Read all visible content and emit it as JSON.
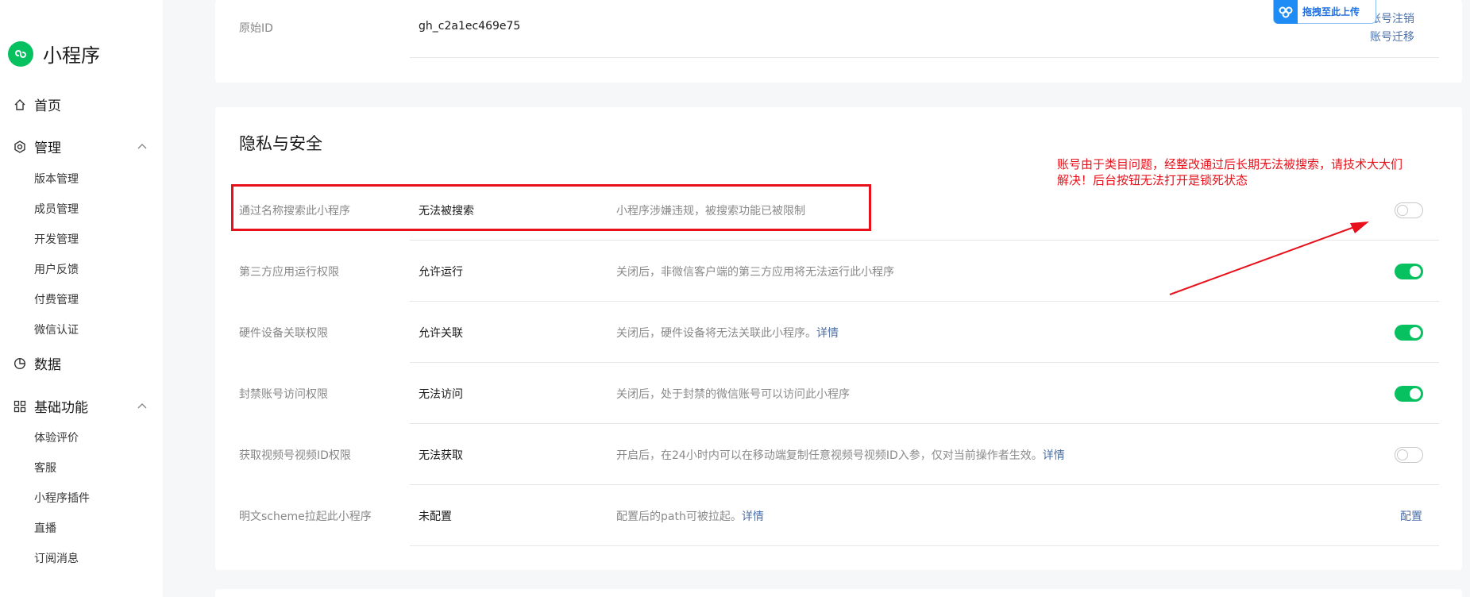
{
  "sidebar": {
    "title": "小程序",
    "items": [
      {
        "label": "首页"
      },
      {
        "label": "管理"
      },
      {
        "label": "数据"
      },
      {
        "label": "基础功能"
      }
    ],
    "manage_sub": [
      "版本管理",
      "成员管理",
      "开发管理",
      "用户反馈",
      "付费管理",
      "微信认证"
    ],
    "basic_sub": [
      "体验评价",
      "客服",
      "小程序插件",
      "直播",
      "订阅消息"
    ]
  },
  "top_card": {
    "label": "原始ID",
    "value": "gh_c2a1ec469e75",
    "link_cancel": "账号注销",
    "link_migrate": "账号迁移"
  },
  "upload_button": {
    "label": "拖拽至此上传"
  },
  "privacy": {
    "title": "隐私与安全",
    "rows": [
      {
        "label": "通过名称搜索此小程序",
        "value": "无法被搜索",
        "desc": "小程序涉嫌违规，被搜索功能已被限制",
        "link": "",
        "toggle": "off"
      },
      {
        "label": "第三方应用运行权限",
        "value": "允许运行",
        "desc": "关闭后，非微信客户端的第三方应用将无法运行此小程序",
        "link": "",
        "toggle": "on"
      },
      {
        "label": "硬件设备关联权限",
        "value": "允许关联",
        "desc": "关闭后，硬件设备将无法关联此小程序。",
        "link": "详情",
        "toggle": "on"
      },
      {
        "label": "封禁账号访问权限",
        "value": "无法访问",
        "desc": "关闭后，处于封禁的微信账号可以访问此小程序",
        "link": "",
        "toggle": "on"
      },
      {
        "label": "获取视频号视频ID权限",
        "value": "无法获取",
        "desc": "开启后，在24小时内可以在移动端复制任意视频号视频ID入参，仅对当前操作者生效。",
        "link": "详情",
        "toggle": "off"
      },
      {
        "label": "明文scheme拉起此小程序",
        "value": "未配置",
        "desc": "配置后的path可被拉起。",
        "link": "详情",
        "action": "配置"
      }
    ]
  },
  "annotation": {
    "text": "账号由于类目问题，经整改通过后长期无法被搜索，请技术大大们解决！后台按钮无法打开是锁死状态"
  },
  "colors": {
    "brand": "#07c160",
    "link": "#4c6fa8",
    "annotation": "#e8101a"
  }
}
